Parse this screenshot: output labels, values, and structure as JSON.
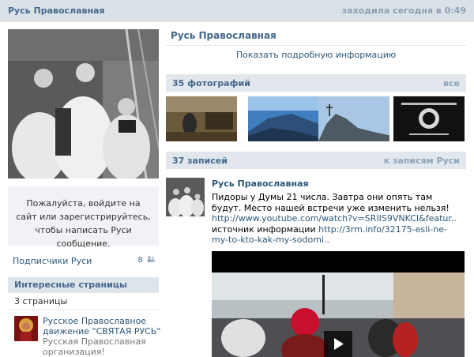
{
  "topbar": {
    "title": "Русь Православная",
    "status": "заходила сегодня в 0:49"
  },
  "left": {
    "login_prompt": "Пожалуйста, войдите на сайт или зарегистрируйтесь, чтобы написать Руси сообщение.",
    "subscribers_label": "Подписчики Руси",
    "subscribers_count": "8",
    "interesting_header": "Интересные страницы",
    "pages_count": "3 страницы",
    "page_item": {
      "name": "Русское Православное движение \"СВЯТАЯ РУСЬ\"",
      "desc": "Русская Православная организация!"
    }
  },
  "main": {
    "group_title": "Русь Православная",
    "show_info": "Показать подробную информацию",
    "photos": {
      "header": "35 фотографий",
      "all_link": "все"
    },
    "posts": {
      "header": "37 записей",
      "link": "к записям Руси",
      "author": "Русь Православная",
      "text": "Пидоры у Думы 21 числа. Завтра они опять там будут. Место нашей встречи уже изменить нельзя!",
      "url1": "http://www.youtube.com/watch?v=SRIIS9VNKCI&featur..",
      "source_label": "источник информации",
      "url2": "http://3rm.info/32175-esli-ne-my-to-kto-kak-my-sodomi.."
    }
  },
  "icons": {
    "subscribers": "people-icon",
    "play": "play-icon"
  }
}
